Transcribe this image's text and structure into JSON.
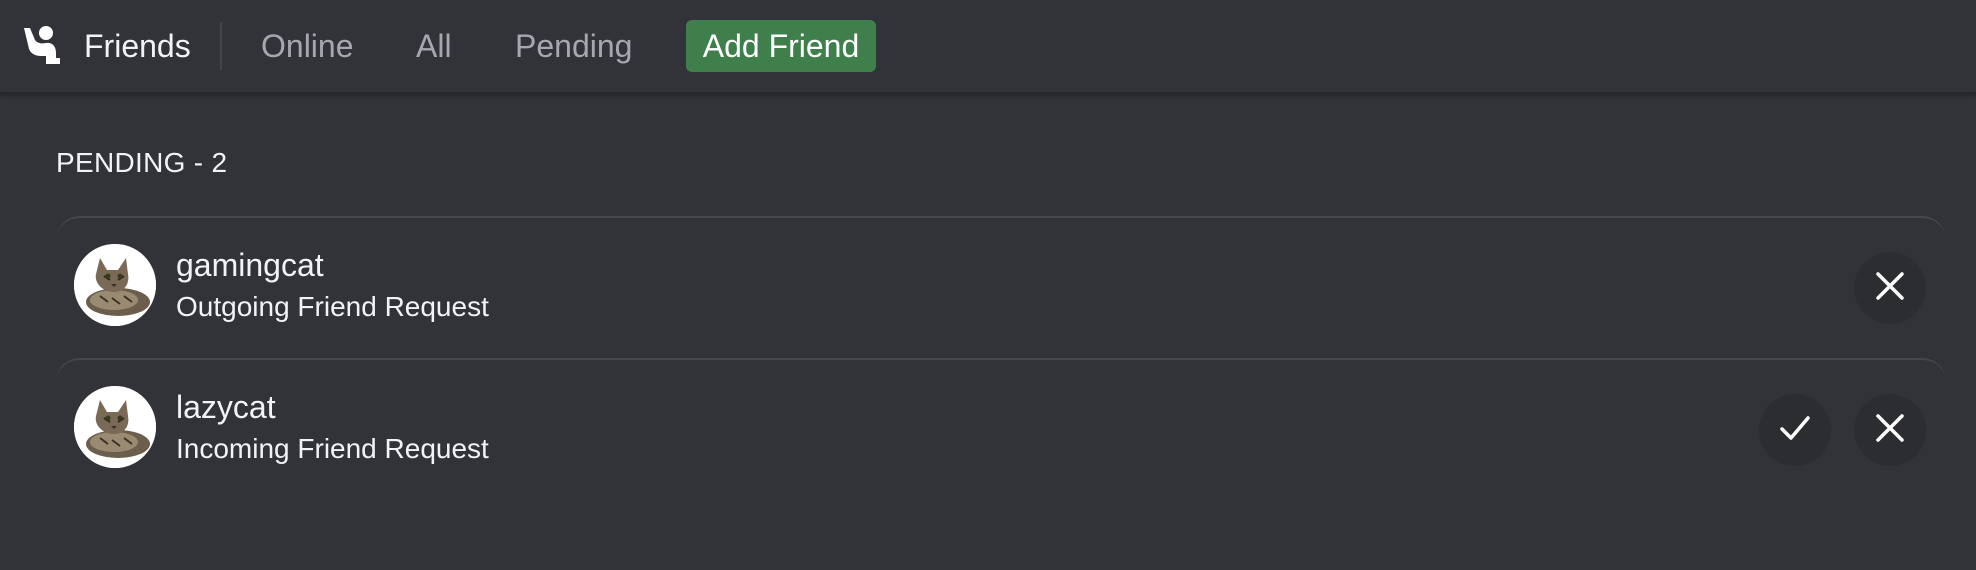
{
  "header": {
    "title": "Friends",
    "tabs": [
      {
        "label": "Online"
      },
      {
        "label": "All"
      },
      {
        "label": "Pending"
      }
    ],
    "add_friend_label": "Add Friend",
    "add_friend_color": "#3e7f4b"
  },
  "pending": {
    "header": "PENDING - 2",
    "requests": [
      {
        "username": "gamingcat",
        "status": "Outgoing Friend Request",
        "avatar_icon": "cat-avatar",
        "actions": [
          "close-icon"
        ]
      },
      {
        "username": "lazycat",
        "status": "Incoming Friend Request",
        "avatar_icon": "cat-avatar",
        "actions": [
          "check-icon",
          "close-icon"
        ]
      }
    ]
  },
  "colors": {
    "background": "#313338",
    "text": "#f2f3f5",
    "muted_tab": "#a5a8ae",
    "action_button": "#2b2d31"
  }
}
